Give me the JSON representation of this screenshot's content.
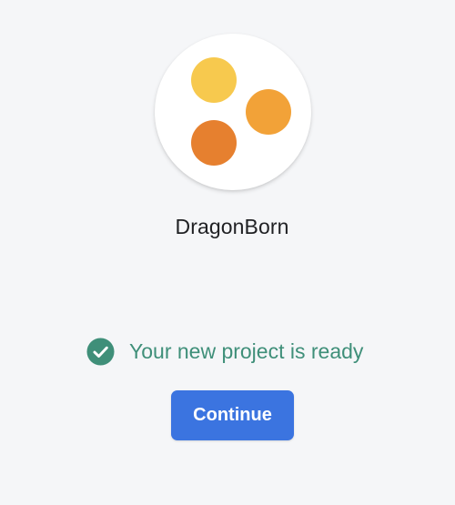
{
  "project": {
    "name": "DragonBorn",
    "logo_colors": [
      "#f7c94e",
      "#f2a238",
      "#e6802f"
    ]
  },
  "status": {
    "icon": "check-circle-icon",
    "text": "Your new project is ready",
    "color": "#3f8f79"
  },
  "actions": {
    "continue_label": "Continue",
    "button_color": "#3b74e0"
  }
}
